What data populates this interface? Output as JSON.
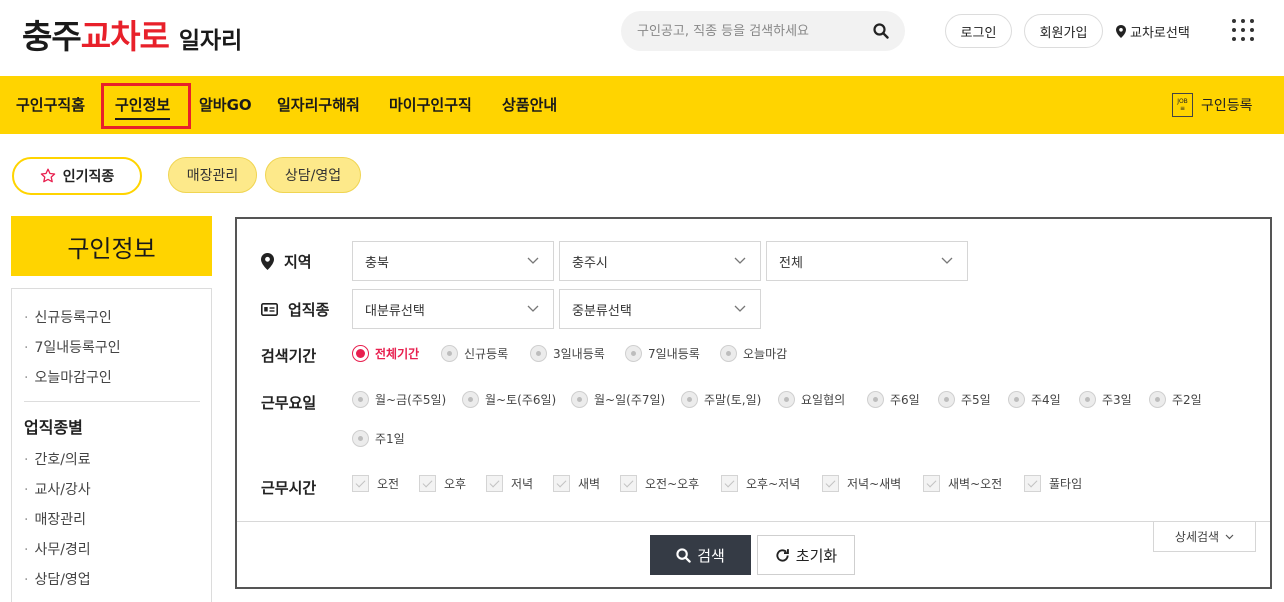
{
  "header": {
    "logo_part1": "충주",
    "logo_part2": "교차로",
    "logo_part3": "일자리",
    "search_placeholder": "구인공고, 직종 등을 검색하세요",
    "login": "로그인",
    "signup": "회원가입",
    "location": "교차로선택"
  },
  "nav": {
    "items": [
      "구인구직홈",
      "구인정보",
      "알바GO",
      "일자리구해줘",
      "마이구인구직",
      "상품안내"
    ],
    "active_index": 1,
    "register": "구인등록",
    "register_icon_text": "JOB"
  },
  "chips": {
    "popular": "인기직종",
    "items": [
      "매장관리",
      "상담/영업"
    ]
  },
  "sidebar": {
    "title": "구인정보",
    "links": [
      "신규등록구인",
      "7일내등록구인",
      "오늘마감구인"
    ],
    "category_title": "업직종별",
    "categories": [
      "간호/의료",
      "교사/강사",
      "매장관리",
      "사무/경리",
      "상담/영업"
    ]
  },
  "filters": {
    "region": {
      "label": "지역",
      "selects": [
        "충북",
        "충주시",
        "전체"
      ]
    },
    "job": {
      "label": "업직종",
      "selects": [
        "대분류선택",
        "중분류선택"
      ]
    },
    "period": {
      "label": "검색기간",
      "options": [
        "전체기간",
        "신규등록",
        "3일내등록",
        "7일내등록",
        "오늘마감"
      ],
      "selected_index": 0
    },
    "days": {
      "label": "근무요일",
      "options": [
        "월~금(주5일)",
        "월~토(주6일)",
        "월~일(주7일)",
        "주말(토,일)",
        "요일협의",
        "주6일",
        "주5일",
        "주4일",
        "주3일",
        "주2일",
        "주1일"
      ]
    },
    "hours": {
      "label": "근무시간",
      "options": [
        "오전",
        "오후",
        "저녁",
        "새벽",
        "오전~오후",
        "오후~저녁",
        "저녁~새벽",
        "새벽~오전",
        "풀타임"
      ]
    }
  },
  "actions": {
    "search": "검색",
    "reset": "초기화",
    "detail": "상세검색"
  },
  "colors": {
    "brand_yellow": "#ffd400",
    "brand_red": "#e8202a",
    "radio_active": "#e8204f",
    "search_button": "#353b45"
  }
}
